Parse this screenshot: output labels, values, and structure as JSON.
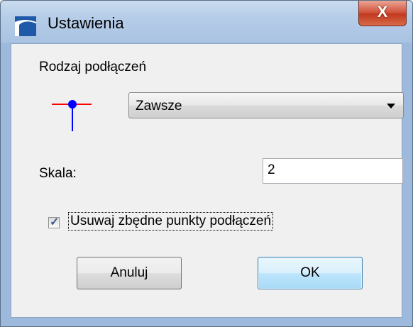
{
  "window": {
    "title": "Ustawienia",
    "close_glyph": "X"
  },
  "connection_type": {
    "label": "Rodzaj podłączeń",
    "icon": "connection-point-icon",
    "selected": "Zawsze"
  },
  "scale": {
    "label": "Skala:",
    "value": "2"
  },
  "remove_points": {
    "label": "Usuwaj zbędne punkty podłączeń",
    "checked": true
  },
  "buttons": {
    "cancel": "Anuluj",
    "ok": "OK"
  },
  "colors": {
    "titlebar": "#b6cde8",
    "close": "#c23a20",
    "icon_blue": "#0000ff",
    "icon_red": "#ff0000"
  }
}
